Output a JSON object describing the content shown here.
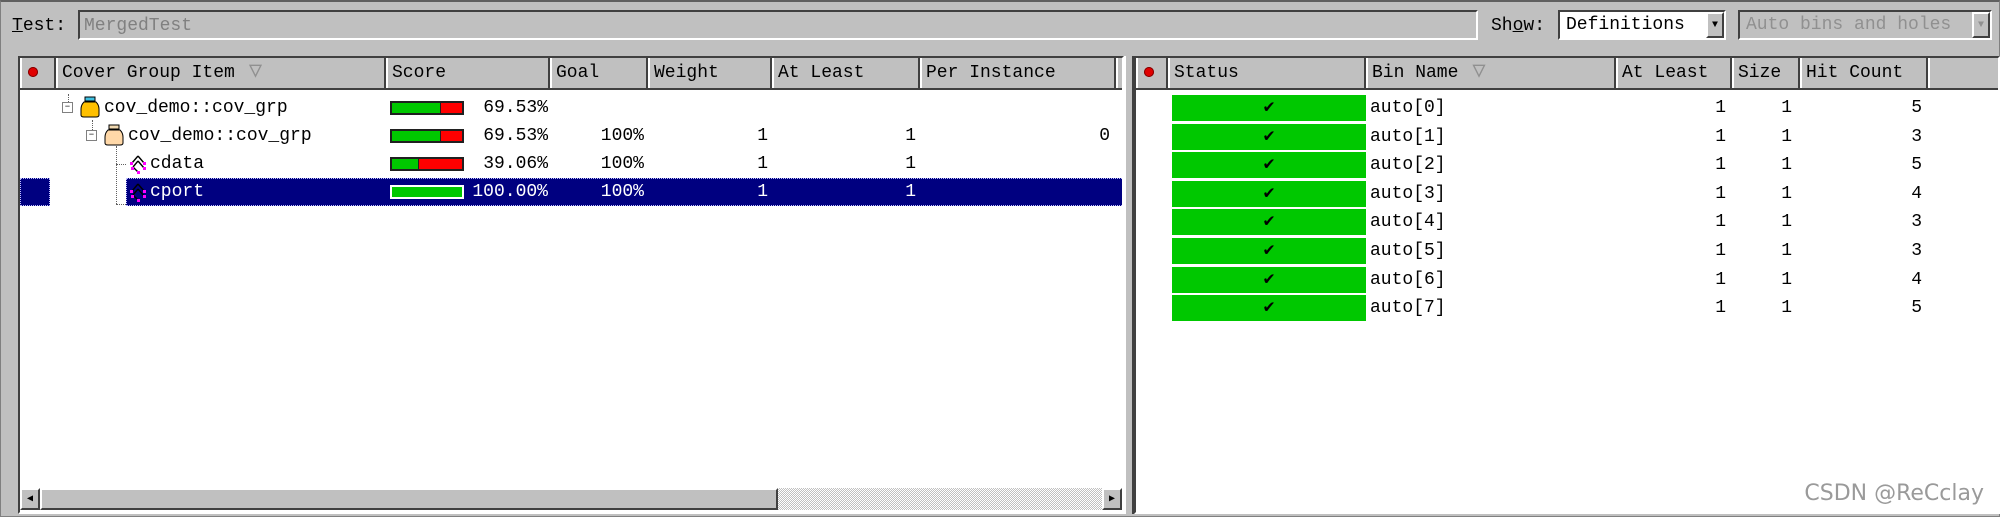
{
  "toolbar": {
    "test_label": "Test:",
    "test_value": "MergedTest",
    "show_label": "Show:",
    "show_value": "Definitions",
    "filter_value": "Auto bins and holes"
  },
  "left_table": {
    "columns": [
      "Cover Group Item",
      "Score",
      "Goal",
      "Weight",
      "At Least",
      "Per Instance"
    ],
    "rows": [
      {
        "name": "cov_demo::cov_grp",
        "icon": "covergroup-jar-icon",
        "score_pct": "69.53%",
        "score_fraction": 0.6953,
        "goal": "",
        "weight": "",
        "at_least": "",
        "per_instance": ""
      },
      {
        "name": "cov_demo::cov_grp",
        "icon": "covergroup-instance-jar-icon",
        "score_pct": "69.53%",
        "score_fraction": 0.6953,
        "goal": "100%",
        "weight": "1",
        "at_least": "1",
        "per_instance": "0"
      },
      {
        "name": "cdata",
        "icon": "coverpoint-icon",
        "score_pct": "39.06%",
        "score_fraction": 0.3906,
        "goal": "100%",
        "weight": "1",
        "at_least": "1",
        "per_instance": ""
      },
      {
        "name": "cport",
        "icon": "coverpoint-icon",
        "score_pct": "100.00%",
        "score_fraction": 1.0,
        "goal": "100%",
        "weight": "1",
        "at_least": "1",
        "per_instance": "",
        "selected": true
      }
    ]
  },
  "right_table": {
    "columns": [
      "Status",
      "Bin Name",
      "At Least",
      "Size",
      "Hit Count"
    ],
    "status_glyph": "✔",
    "status_color": "#00c800",
    "rows": [
      {
        "bin": "auto[0]",
        "at_least": "1",
        "size": "1",
        "hit_count": "5"
      },
      {
        "bin": "auto[1]",
        "at_least": "1",
        "size": "1",
        "hit_count": "3"
      },
      {
        "bin": "auto[2]",
        "at_least": "1",
        "size": "1",
        "hit_count": "5"
      },
      {
        "bin": "auto[3]",
        "at_least": "1",
        "size": "1",
        "hit_count": "4"
      },
      {
        "bin": "auto[4]",
        "at_least": "1",
        "size": "1",
        "hit_count": "3"
      },
      {
        "bin": "auto[5]",
        "at_least": "1",
        "size": "1",
        "hit_count": "3"
      },
      {
        "bin": "auto[6]",
        "at_least": "1",
        "size": "1",
        "hit_count": "4"
      },
      {
        "bin": "auto[7]",
        "at_least": "1",
        "size": "1",
        "hit_count": "5"
      }
    ]
  },
  "watermark": "CSDN @ReCclay"
}
